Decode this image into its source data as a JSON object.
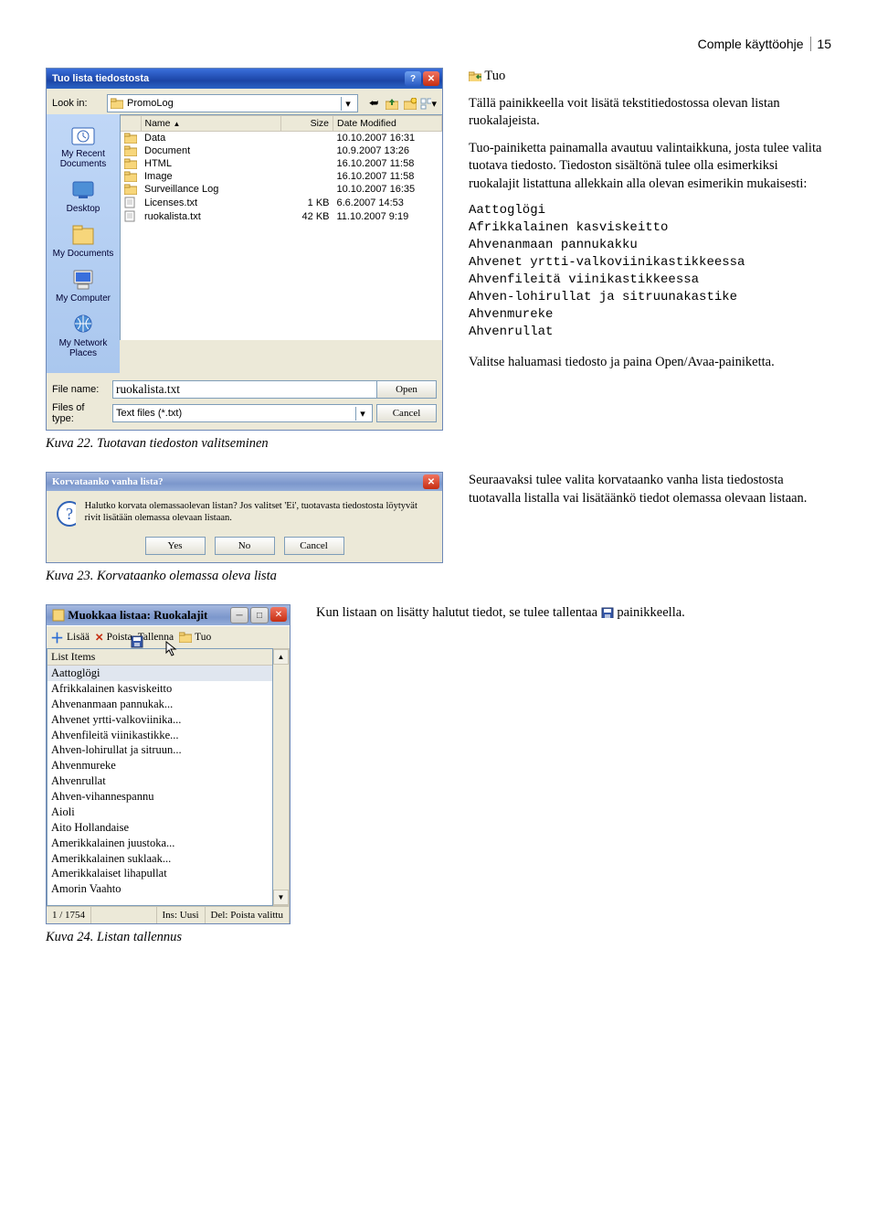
{
  "page_header": {
    "title": "Comple käyttöohje",
    "page_number": "15"
  },
  "section1": {
    "heading": "Tuo",
    "p1": "Tällä painikkeella voit lisätä tekstitiedostossa olevan listan ruokalajeista.",
    "p2": "Tuo-painiketta painamalla avautuu valintaikkuna, josta tulee valita tuotava tiedosto. Tiedoston sisältönä tulee olla esimerkiksi ruokalajit listattuna allekkain alla olevan esimerikin mukaisesti:",
    "mono": "Aattoglögi\nAfrikkalainen kasviskeitto\nAhvenanmaan pannukakku\nAhvenet yrtti-valkoviinikastikkeessa\nAhvenfileitä viinikastikkeessa\nAhven-lohirullat ja sitruunakastike\nAhvenmureke\nAhvenrullat",
    "p3": "Valitse haluamasi tiedosto ja paina Open/Avaa-painiketta."
  },
  "dialog1": {
    "title": "Tuo lista tiedostosta",
    "lookin_label": "Look in:",
    "lookin_value": "PromoLog",
    "places": [
      "My Recent Documents",
      "Desktop",
      "My Documents",
      "My Computer",
      "My Network Places"
    ],
    "columns": {
      "name": "Name",
      "size": "Size",
      "date": "Date Modified"
    },
    "files": [
      {
        "icon": "folder",
        "name": "Data",
        "size": "",
        "date": "10.10.2007 16:31"
      },
      {
        "icon": "folder",
        "name": "Document",
        "size": "",
        "date": "10.9.2007 13:26"
      },
      {
        "icon": "folder",
        "name": "HTML",
        "size": "",
        "date": "16.10.2007 11:58"
      },
      {
        "icon": "folder",
        "name": "Image",
        "size": "",
        "date": "16.10.2007 11:58"
      },
      {
        "icon": "folder",
        "name": "Surveillance Log",
        "size": "",
        "date": "10.10.2007 16:35"
      },
      {
        "icon": "file",
        "name": "Licenses.txt",
        "size": "1 KB",
        "date": "6.6.2007 14:53"
      },
      {
        "icon": "file",
        "name": "ruokalista.txt",
        "size": "42 KB",
        "date": "11.10.2007 9:19"
      }
    ],
    "filename_label": "File name:",
    "filename_value": "ruokalista.txt",
    "filetype_label": "Files of type:",
    "filetype_value": "Text files (*.txt)",
    "open": "Open",
    "cancel": "Cancel"
  },
  "caption1": "Kuva 22. Tuotavan tiedoston valitseminen",
  "confirm": {
    "title": "Korvataanko vanha lista?",
    "text": "Halutko korvata olemassaolevan listan? Jos valitset 'Ei', tuotavasta tiedostosta löytyvät rivit lisätään olemassa olevaan listaan.",
    "yes": "Yes",
    "no": "No",
    "cancel": "Cancel"
  },
  "caption2": "Kuva 23. Korvataanko olemassa oleva lista",
  "section2": {
    "p1": "Seuraavaksi tulee valita korvataanko vanha lista tiedostosta tuotavalla listalla vai lisätäänkö tiedot olemassa olevaan listaan."
  },
  "section3": {
    "p1": "Kun listaan on lisätty halutut tiedot, se tulee tallentaa",
    "p2": "painikkeella."
  },
  "listedit": {
    "title": "Muokkaa listaa: Ruokalajit",
    "toolbar": {
      "add": "Lisää",
      "del": "Poista",
      "save": "Tallenna",
      "import": "Tuo"
    },
    "head": "List Items",
    "items": [
      "Aattoglögi",
      "Afrikkalainen kasviskeitto",
      "Ahvenanmaan pannukak...",
      "Ahvenet yrtti-valkoviinika...",
      "Ahvenfileitä viinikastikke...",
      "Ahven-lohirullat ja sitruun...",
      "Ahvenmureke",
      "Ahvenrullat",
      "Ahven-vihannespannu",
      "Aioli",
      "Aito Hollandaise",
      "Amerikkalainen juustoka...",
      "Amerikkalainen suklaak...",
      "Amerikkalaiset lihapullat",
      "Amorin Vaahto"
    ],
    "status": {
      "count": "1 / 1754",
      "ins": "Ins: Uusi",
      "del": "Del: Poista valittu"
    }
  },
  "caption3": "Kuva 24. Listan tallennus"
}
